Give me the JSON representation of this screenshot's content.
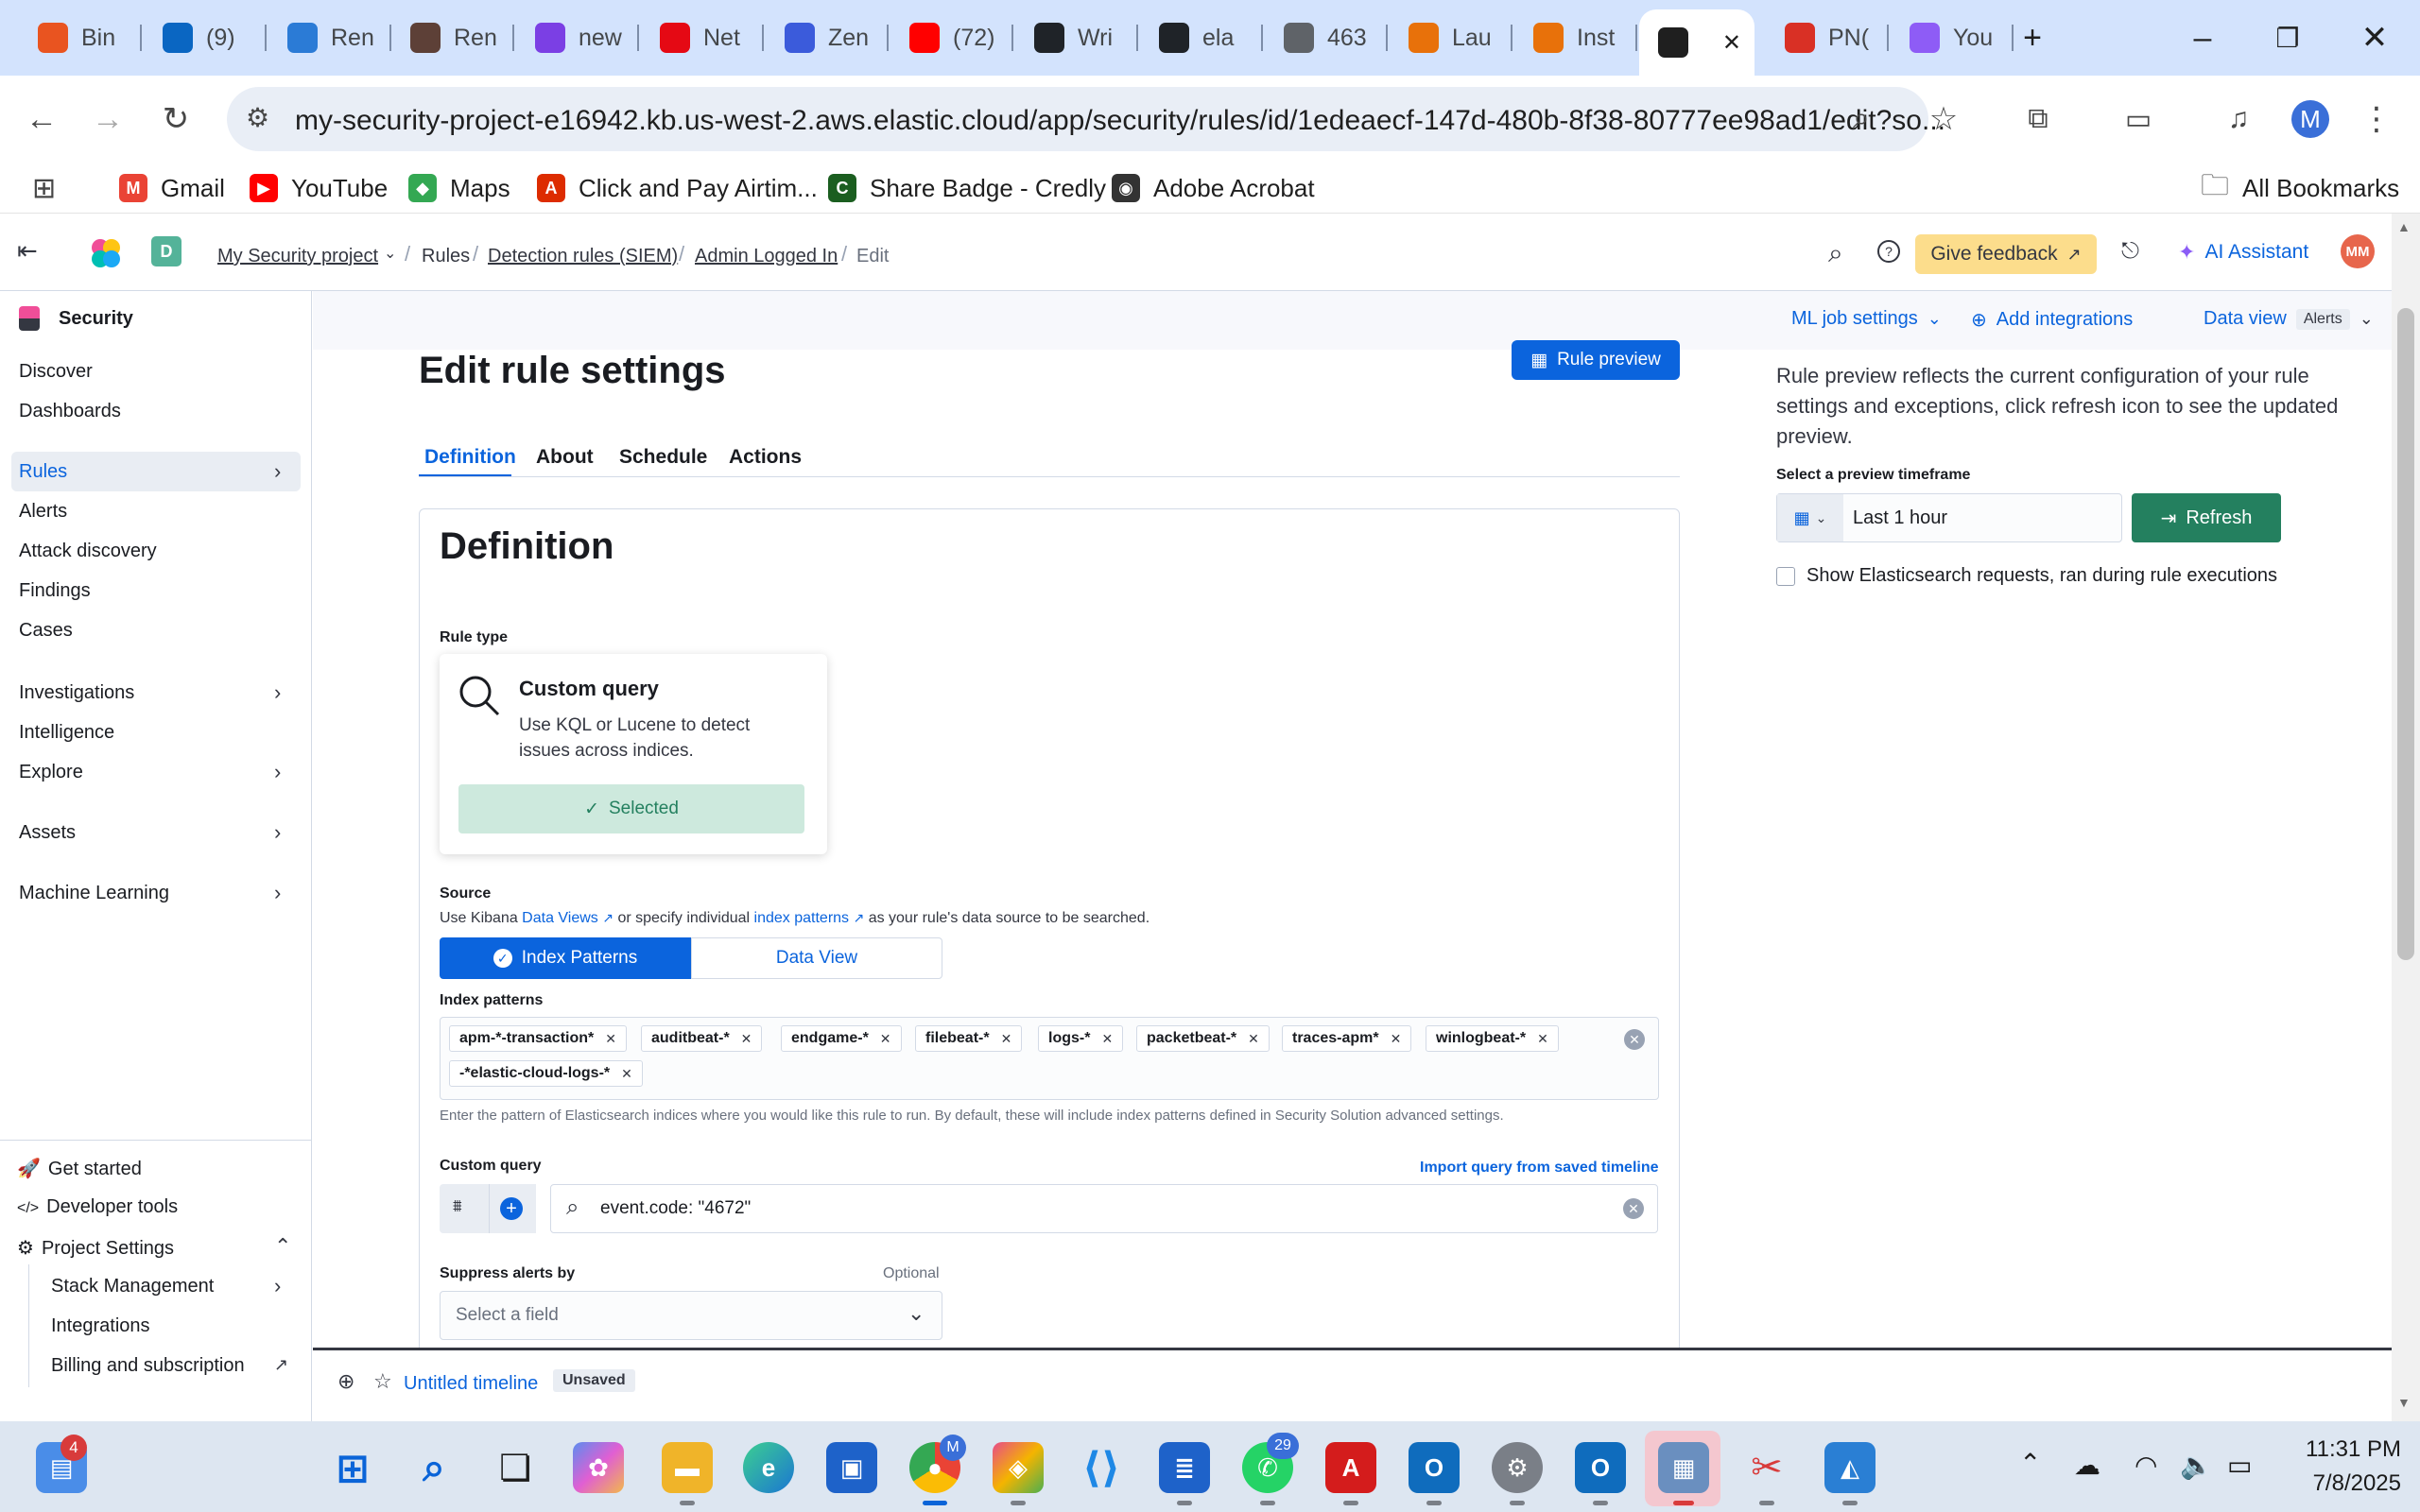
{
  "browser": {
    "tabs": [
      {
        "label": "Bin",
        "icon": "ubuntu-icon",
        "color": "#e95420"
      },
      {
        "label": "(9)",
        "icon": "linkedin-icon",
        "color": "#0a66c2"
      },
      {
        "label": "Ren",
        "icon": "le-icon",
        "color": "#2b7bd6"
      },
      {
        "label": "Ren",
        "icon": "people-icon",
        "color": "#5d4037"
      },
      {
        "label": "new",
        "icon": "peace-icon",
        "color": "#7b3fe4"
      },
      {
        "label": "Net",
        "icon": "netflix-icon",
        "color": "#e50914"
      },
      {
        "label": "Zen",
        "icon": "zen-icon",
        "color": "#3b5bdb"
      },
      {
        "label": "(72)",
        "icon": "youtube-icon",
        "color": "#ff0000"
      },
      {
        "label": "Wri",
        "icon": "github-icon",
        "color": "#1f2328"
      },
      {
        "label": "ela",
        "icon": "github-icon",
        "color": "#1f2328"
      },
      {
        "label": "463",
        "icon": "globe-icon",
        "color": "#5f6368"
      },
      {
        "label": "Lau",
        "icon": "launch-icon",
        "color": "#e8710a"
      },
      {
        "label": "Inst",
        "icon": "launch-icon",
        "color": "#e8710a"
      },
      {
        "label": "",
        "icon": "openai-icon",
        "color": "#1f1f1f"
      },
      {
        "label": "PN(",
        "icon": "png-jpg-icon",
        "color": "#d93025"
      },
      {
        "label": "You",
        "icon": "notebook-icon",
        "color": "#8e5cf6"
      }
    ],
    "url": "my-security-project-e16942.kb.us-west-2.aws.elastic.cloud/app/security/rules/id/1edeaecf-147d-480b-8f38-80777ee98ad1/edit?so...",
    "profile_initial": "M",
    "bookmarks": [
      {
        "label": "Gmail",
        "color": "#ea4335",
        "glyph": "M"
      },
      {
        "label": "YouTube",
        "color": "#ff0000",
        "glyph": "▶"
      },
      {
        "label": "Maps",
        "color": "#34a853",
        "glyph": "◆"
      },
      {
        "label": "Click and Pay Airtim...",
        "color": "#dd2c00",
        "glyph": "A"
      },
      {
        "label": "Share Badge - Credly",
        "color": "#1b5e20",
        "glyph": "C"
      },
      {
        "label": "Adobe Acrobat",
        "color": "#333333",
        "glyph": "◉"
      }
    ],
    "all_bookmarks": "All Bookmarks"
  },
  "kibana": {
    "space_initial": "D",
    "breadcrumbs": [
      "My Security project",
      "Rules",
      "Detection rules (SIEM)",
      "Admin Logged In",
      "Edit"
    ],
    "feedback": "Give feedback",
    "ai_assistant": "AI Assistant",
    "user_initials": "MM"
  },
  "sidenav": {
    "title": "Security",
    "items": [
      "Discover",
      "Dashboards",
      "Rules",
      "Alerts",
      "Attack discovery",
      "Findings",
      "Cases",
      "Investigations",
      "Intelligence",
      "Explore",
      "Assets",
      "Machine Learning"
    ],
    "footer": [
      "Get started",
      "Developer tools",
      "Project Settings",
      "Stack Management",
      "Integrations",
      "Billing and subscription"
    ]
  },
  "topbar": {
    "ml_job_settings": "ML job settings",
    "add_integrations": "Add integrations",
    "data_view": "Data view",
    "data_view_value": "Alerts"
  },
  "page": {
    "title": "Edit rule settings",
    "rule_preview_button": "Rule preview",
    "tabs": [
      "Definition",
      "About",
      "Schedule",
      "Actions"
    ]
  },
  "definition": {
    "heading": "Definition",
    "rule_type_label": "Rule type",
    "rule_type_title": "Custom query",
    "rule_type_desc": "Use KQL or Lucene to detect issues across indices.",
    "selected": "Selected",
    "source_label": "Source",
    "source_help_1": "Use Kibana",
    "source_help_link1": "Data Views",
    "source_help_2": "or specify individual",
    "source_help_link2": "index patterns",
    "source_help_3": "as your rule's data source to be searched.",
    "index_patterns_tab": "Index Patterns",
    "data_view_tab": "Data View",
    "index_patterns_label": "Index patterns",
    "index_patterns": [
      "apm-*-transaction*",
      "auditbeat-*",
      "endgame-*",
      "filebeat-*",
      "logs-*",
      "packetbeat-*",
      "traces-apm*",
      "winlogbeat-*",
      "-*elastic-cloud-logs-*"
    ],
    "index_help": "Enter the pattern of Elasticsearch indices where you would like this rule to run. By default, these will include index patterns defined in Security Solution advanced settings.",
    "custom_query_label": "Custom query",
    "import_query": "Import query from saved timeline",
    "query_value": "event.code: \"4672\"",
    "suppress_label": "Suppress alerts by",
    "optional": "Optional",
    "suppress_placeholder": "Select a field"
  },
  "preview": {
    "description": "Rule preview reflects the current configuration of your rule settings and exceptions, click refresh icon to see the updated preview.",
    "timeframe_label": "Select a preview timeframe",
    "timeframe_value": "Last 1 hour",
    "refresh": "Refresh",
    "show_requests": "Show Elasticsearch requests, ran during rule executions"
  },
  "timeline": {
    "title": "Untitled timeline",
    "badge": "Unsaved"
  },
  "taskbar": {
    "time": "11:31 PM",
    "date": "7/8/2025",
    "badge_mail": "4",
    "badge_chrome": "M",
    "badge_whatsapp": "29"
  }
}
